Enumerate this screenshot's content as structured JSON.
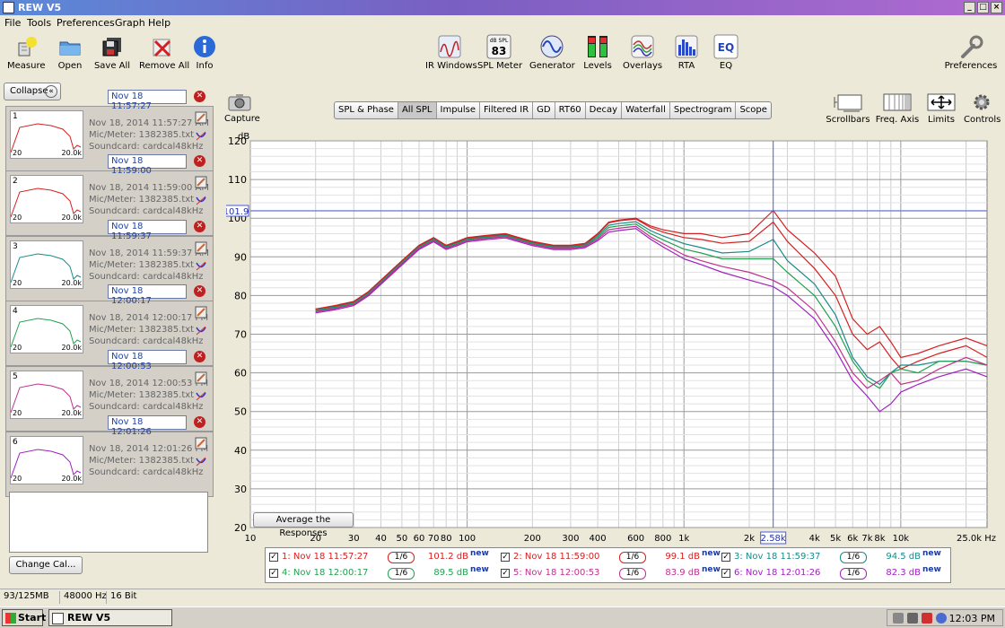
{
  "window": {
    "title": "REW V5"
  },
  "menu": [
    "File",
    "Tools",
    "Preferences",
    "Graph",
    "Help"
  ],
  "toolbar_left": [
    {
      "label": "Measure",
      "icon": "measure-icon"
    },
    {
      "label": "Open",
      "icon": "folder-icon"
    },
    {
      "label": "Save All",
      "icon": "save-all-icon"
    },
    {
      "label": "Remove All",
      "icon": "remove-all-icon"
    },
    {
      "label": "Info",
      "icon": "info-icon"
    }
  ],
  "toolbar_center": [
    {
      "label": "IR Windows",
      "icon": "ir-windows-icon"
    },
    {
      "label": "SPL Meter",
      "icon": "spl-meter-icon",
      "badge": "dB SPL",
      "value": "83"
    },
    {
      "label": "Generator",
      "icon": "generator-icon"
    },
    {
      "label": "Levels",
      "icon": "levels-icon"
    },
    {
      "label": "Overlays",
      "icon": "overlays-icon"
    },
    {
      "label": "RTA",
      "icon": "rta-icon"
    },
    {
      "label": "EQ",
      "icon": "eq-icon",
      "badge": "EQ"
    }
  ],
  "toolbar_right": {
    "label": "Preferences",
    "icon": "wrench-icon"
  },
  "left_panel": {
    "collapse_label": "Collapse",
    "change_cal_label": "Change Cal...",
    "measurements": [
      {
        "num": "1",
        "date_field": "Nov 18 11:57:27",
        "timestamp": "Nov 18, 2014 11:57:27 AM",
        "mic": "Mic/Meter: 1382385.txt",
        "soundcard": "Soundcard: cardcal48kHz",
        "color": "#d42020",
        "axis_left": "20",
        "axis_right": "20.0k"
      },
      {
        "num": "2",
        "date_field": "Nov 18 11:59:00",
        "timestamp": "Nov 18, 2014 11:59:00 AM",
        "mic": "Mic/Meter: 1382385.txt",
        "soundcard": "Soundcard: cardcal48kHz",
        "color": "#d42020",
        "axis_left": "20",
        "axis_right": "20.0k"
      },
      {
        "num": "3",
        "date_field": "Nov 18 11:59:37",
        "timestamp": "Nov 18, 2014 11:59:37 AM",
        "mic": "Mic/Meter: 1382385.txt",
        "soundcard": "Soundcard: cardcal48kHz",
        "color": "#1a8a8a",
        "axis_left": "20",
        "axis_right": "20.0k"
      },
      {
        "num": "4",
        "date_field": "Nov 18 12:00:17",
        "timestamp": "Nov 18, 2014 12:00:17 PM",
        "mic": "Mic/Meter: 1382385.txt",
        "soundcard": "Soundcard: cardcal48kHz",
        "color": "#22a050",
        "axis_left": "20",
        "axis_right": "20.0k"
      },
      {
        "num": "5",
        "date_field": "Nov 18 12:00:53",
        "timestamp": "Nov 18, 2014 12:00:53 PM",
        "mic": "Mic/Meter: 1382385.txt",
        "soundcard": "Soundcard: cardcal48kHz",
        "color": "#c03090",
        "axis_left": "20",
        "axis_right": "20.0k"
      },
      {
        "num": "6",
        "date_field": "Nov 18 12:01:26",
        "timestamp": "Nov 18, 2014 12:01:26 PM",
        "mic": "Mic/Meter: 1382385.txt",
        "soundcard": "Soundcard: cardcal48kHz",
        "color": "#a020c0",
        "axis_left": "20",
        "axis_right": "20.0k"
      }
    ]
  },
  "capture_label": "Capture",
  "tabs": [
    {
      "label": "SPL & Phase",
      "active": false
    },
    {
      "label": "All SPL",
      "active": true
    },
    {
      "label": "Impulse",
      "active": false
    },
    {
      "label": "Filtered IR",
      "active": false
    },
    {
      "label": "GD",
      "active": false
    },
    {
      "label": "RT60",
      "active": false
    },
    {
      "label": "Decay",
      "active": false
    },
    {
      "label": "Waterfall",
      "active": false
    },
    {
      "label": "Spectrogram",
      "active": false
    },
    {
      "label": "Scope",
      "active": false
    }
  ],
  "right_tools": [
    {
      "label": "Scrollbars",
      "icon": "scrollbars-icon"
    },
    {
      "label": "Freq. Axis",
      "icon": "freq-axis-icon"
    },
    {
      "label": "Limits",
      "icon": "limits-icon"
    },
    {
      "label": "Controls",
      "icon": "controls-icon"
    }
  ],
  "average_button": "Average the Responses",
  "chart_data": {
    "type": "line",
    "ylabel": "dB",
    "xunit": "Hz",
    "xscale": "log",
    "xlim": [
      10,
      25000
    ],
    "ylim": [
      20,
      120
    ],
    "yticks": [
      20,
      30,
      40,
      50,
      60,
      70,
      80,
      90,
      100,
      110,
      120
    ],
    "xtick_labels": [
      {
        "v": 10,
        "t": "10"
      },
      {
        "v": 20,
        "t": "20"
      },
      {
        "v": 30,
        "t": "30"
      },
      {
        "v": 40,
        "t": "40"
      },
      {
        "v": 50,
        "t": "50"
      },
      {
        "v": 60,
        "t": "60"
      },
      {
        "v": 70,
        "t": "70"
      },
      {
        "v": 80,
        "t": "80"
      },
      {
        "v": 100,
        "t": "100"
      },
      {
        "v": 200,
        "t": "200"
      },
      {
        "v": 300,
        "t": "300"
      },
      {
        "v": 400,
        "t": "400"
      },
      {
        "v": 600,
        "t": "600"
      },
      {
        "v": 800,
        "t": "800"
      },
      {
        "v": 1000,
        "t": "1k"
      },
      {
        "v": 2000,
        "t": "2k"
      },
      {
        "v": 4000,
        "t": "4k"
      },
      {
        "v": 5000,
        "t": "5k"
      },
      {
        "v": 6000,
        "t": "6k"
      },
      {
        "v": 7000,
        "t": "7k"
      },
      {
        "v": 8000,
        "t": "8k"
      },
      {
        "v": 10000,
        "t": "10k"
      },
      {
        "v": 25000,
        "t": "25.0k Hz"
      }
    ],
    "cursor": {
      "freq": 2580,
      "freq_label": "2.58k",
      "level": 101.9,
      "level_label": "101.9"
    },
    "x": [
      20,
      25,
      30,
      35,
      40,
      50,
      60,
      70,
      80,
      90,
      100,
      120,
      150,
      200,
      250,
      300,
      350,
      400,
      450,
      500,
      600,
      700,
      800,
      1000,
      1200,
      1500,
      2000,
      2580,
      3000,
      4000,
      5000,
      6000,
      7000,
      8000,
      9000,
      10000,
      12000,
      15000,
      20000,
      25000
    ],
    "series": [
      {
        "name": "1: Nov 18 11:57:27",
        "color": "#d42020",
        "values": [
          76.5,
          77.5,
          78.5,
          81,
          84,
          89,
          93,
          95,
          93,
          94,
          95,
          95.5,
          96,
          94,
          93,
          93,
          93.5,
          96,
          99,
          99.5,
          100,
          98,
          97,
          96,
          96,
          95,
          96,
          102,
          97,
          91,
          85,
          74,
          70,
          72,
          68,
          64,
          65,
          67,
          69,
          67
        ]
      },
      {
        "name": "2: Nov 18 11:59:00",
        "color": "#d42020",
        "values": [
          76.5,
          77.3,
          78.3,
          80.8,
          83.8,
          88.8,
          92.8,
          94.8,
          92.8,
          93.8,
          94.8,
          95.3,
          95.8,
          93.8,
          92.8,
          92.8,
          93.3,
          95.8,
          98.8,
          99.3,
          99.8,
          97.6,
          96.4,
          95,
          94.5,
          93.5,
          94,
          99,
          94,
          87,
          80,
          70,
          66,
          68,
          64,
          61,
          63,
          65,
          67,
          64
        ]
      },
      {
        "name": "3: Nov 18 11:59:37",
        "color": "#1a8a8a",
        "values": [
          76.2,
          77.1,
          78.1,
          80.6,
          83.6,
          88.6,
          92.6,
          94.6,
          92.6,
          93.6,
          94.6,
          95.1,
          95.6,
          93.6,
          92.6,
          92.6,
          93.1,
          95.4,
          98.2,
          98.6,
          99.1,
          96.8,
          95.4,
          93.4,
          92.4,
          91,
          91.4,
          94.5,
          89,
          83,
          75,
          64,
          59,
          57,
          60,
          62,
          62,
          63,
          63,
          62
        ]
      },
      {
        "name": "4: Nov 18 12:00:17",
        "color": "#22a050",
        "values": [
          76,
          76.9,
          77.9,
          80.4,
          83.4,
          88.4,
          92.4,
          94.4,
          92.4,
          93.4,
          94.4,
          94.9,
          95.4,
          93.4,
          92.4,
          92.4,
          92.9,
          95,
          97.6,
          98,
          98.5,
          96,
          94.4,
          92,
          91,
          89.5,
          89.5,
          89.5,
          86,
          80,
          72,
          63,
          58,
          56,
          60,
          61,
          60,
          63,
          63,
          62
        ]
      },
      {
        "name": "5: Nov 18 12:00:53",
        "color": "#c03090",
        "values": [
          75.8,
          76.7,
          77.7,
          80.2,
          83.2,
          88.2,
          92.2,
          94.2,
          92.2,
          93.2,
          94.2,
          94.7,
          95.2,
          93.2,
          92.2,
          92.2,
          92.7,
          94.6,
          97,
          97.4,
          97.9,
          95.2,
          93.4,
          90.5,
          89,
          87.5,
          86,
          83.9,
          82,
          76,
          68,
          60,
          56,
          58,
          60,
          57,
          58,
          61,
          64,
          62
        ]
      },
      {
        "name": "6: Nov 18 12:01:26",
        "color": "#a020c0",
        "values": [
          75.5,
          76.4,
          77.4,
          79.9,
          82.9,
          87.9,
          91.9,
          93.9,
          91.9,
          92.9,
          93.9,
          94.4,
          94.9,
          92.9,
          91.9,
          91.9,
          92.4,
          94.2,
          96.4,
          96.8,
          97.3,
          94.6,
          92.6,
          89.5,
          88,
          86,
          84,
          82.3,
          80,
          74,
          66,
          58,
          54,
          50,
          52,
          55,
          57,
          59,
          61,
          59
        ]
      }
    ]
  },
  "legend": [
    {
      "checked": true,
      "name": "1: Nov 18 11:57:27",
      "smoothing": "1/6",
      "value": "101.2 dB",
      "tag": "new",
      "color": "#d42020"
    },
    {
      "checked": true,
      "name": "2: Nov 18 11:59:00",
      "smoothing": "1/6",
      "value": "99.1 dB",
      "tag": "new",
      "color": "#d42020"
    },
    {
      "checked": true,
      "name": "3: Nov 18 11:59:37",
      "smoothing": "1/6",
      "value": "94.5 dB",
      "tag": "new",
      "color": "#1a8a8a"
    },
    {
      "checked": true,
      "name": "4: Nov 18 12:00:17",
      "smoothing": "1/6",
      "value": "89.5 dB",
      "tag": "new",
      "color": "#22a050"
    },
    {
      "checked": true,
      "name": "5: Nov 18 12:00:53",
      "smoothing": "1/6",
      "value": "83.9 dB",
      "tag": "new",
      "color": "#c03090"
    },
    {
      "checked": true,
      "name": "6: Nov 18 12:01:26",
      "smoothing": "1/6",
      "value": "82.3 dB",
      "tag": "new",
      "color": "#a020c0"
    }
  ],
  "status": {
    "memory": "93/125MB",
    "rate": "48000 Hz",
    "bits": "16 Bit"
  },
  "taskbar": {
    "start": "Start",
    "item": "REW V5",
    "clock": "12:03 PM"
  }
}
